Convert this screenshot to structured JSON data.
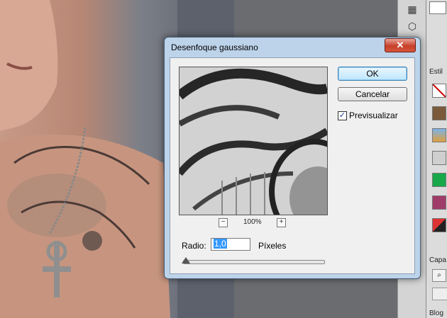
{
  "dialog": {
    "title": "Desenfoque gaussiano",
    "close_symbol": "✕",
    "ok_label": "OK",
    "cancel_label": "Cancelar",
    "preview_checkbox_label": "Previsualizar",
    "preview_checked": true,
    "zoom_level": "100%",
    "zoom_out_symbol": "−",
    "zoom_in_symbol": "+",
    "radius_label": "Radio:",
    "radius_value": "1,0",
    "radius_unit": "Píxeles",
    "radius_slider_fraction": 0.01
  },
  "right_panel": {
    "styles_tab_label": "Estil",
    "layers_tab_label": "Capa",
    "blog_label": "Blog"
  },
  "colors": {
    "dialog_border": "#bcd3ea",
    "close_button": "#c7402b",
    "text_selection": "#3399ff"
  },
  "icons": [
    "close-icon",
    "checkmark-icon",
    "zoom-out-icon",
    "zoom-in-icon",
    "search-icon",
    "cube-icon",
    "chevron-down-icon"
  ]
}
